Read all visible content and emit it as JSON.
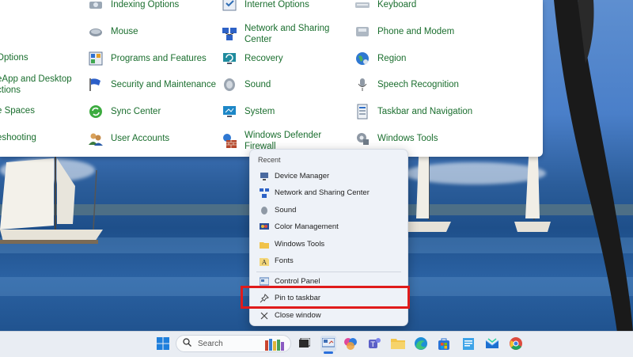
{
  "control_panel": {
    "items": [
      {
        "label": "Indexing Options"
      },
      {
        "label": "Internet Options"
      },
      {
        "label": "Keyboard"
      },
      {
        "label": "Mouse"
      },
      {
        "label": "Network and Sharing Center"
      },
      {
        "label": "Phone and Modem"
      },
      {
        "label": "Options"
      },
      {
        "label": "Programs and Features"
      },
      {
        "label": "Recovery"
      },
      {
        "label": "Region"
      },
      {
        "label": "eApp and Desktop ctions"
      },
      {
        "label": "Security and Maintenance"
      },
      {
        "label": "Sound"
      },
      {
        "label": "Speech Recognition"
      },
      {
        "label": "e Spaces"
      },
      {
        "label": "Sync Center"
      },
      {
        "label": "System"
      },
      {
        "label": "Taskbar and Navigation"
      },
      {
        "label": "eshooting"
      },
      {
        "label": "User Accounts"
      },
      {
        "label": "Windows Defender Firewall"
      },
      {
        "label": "Windows Tools"
      }
    ]
  },
  "jumplist": {
    "section_label": "Recent",
    "recent": [
      {
        "label": "Device Manager",
        "icon": "device-manager-icon"
      },
      {
        "label": "Network and Sharing Center",
        "icon": "network-icon"
      },
      {
        "label": "Sound",
        "icon": "speaker-icon"
      },
      {
        "label": "Color Management",
        "icon": "color-management-icon"
      },
      {
        "label": "Windows Tools",
        "icon": "folder-icon"
      },
      {
        "label": "Fonts",
        "icon": "fonts-icon"
      }
    ],
    "actions": [
      {
        "label": "Control Panel",
        "icon": "control-panel-icon"
      },
      {
        "label": "Pin to taskbar",
        "icon": "pin-icon"
      },
      {
        "label": "Close window",
        "icon": "close-icon"
      }
    ]
  },
  "taskbar": {
    "search_label": "Search"
  },
  "colors": {
    "link_green": "#1a6e2e",
    "highlight_red": "#e01b1b",
    "accent_blue": "#2a6fdb"
  }
}
